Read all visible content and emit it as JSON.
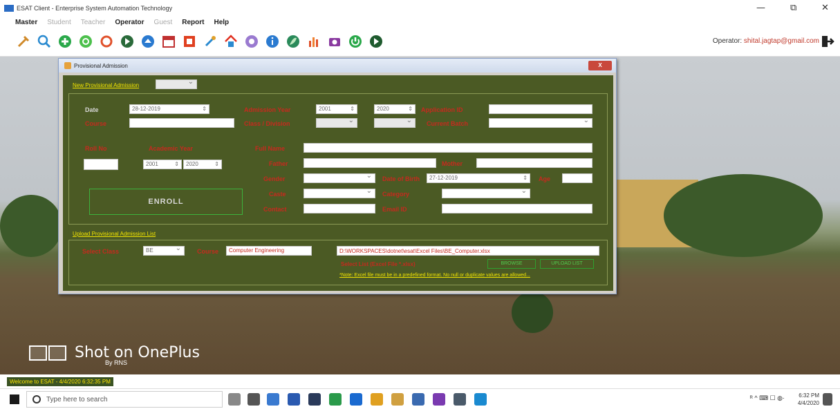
{
  "window": {
    "title": "ESAT Client - Enterprise System Automation Technology",
    "minimize": "—",
    "maximize": "⧉",
    "close": "✕"
  },
  "menu": {
    "items": [
      {
        "label": "Master",
        "enabled": true
      },
      {
        "label": "Student",
        "enabled": false
      },
      {
        "label": "Teacher",
        "enabled": false
      },
      {
        "label": "Operator",
        "enabled": true
      },
      {
        "label": "Guest",
        "enabled": false
      },
      {
        "label": "Report",
        "enabled": true
      },
      {
        "label": "Help",
        "enabled": true
      }
    ]
  },
  "toolbar": {
    "operator_prefix": "Operator: ",
    "operator_email": "shital.jagtap@gmail.com",
    "icons": [
      "tools-icon",
      "search-icon",
      "add-icon",
      "refresh-green-icon",
      "sync-icon",
      "next-icon",
      "upload-icon",
      "calendar-icon",
      "pdf-icon",
      "pin-icon",
      "home-icon",
      "flower-icon",
      "info-icon",
      "leaf-icon",
      "chart-icon",
      "camera-icon",
      "power-icon",
      "arrow-right-icon"
    ]
  },
  "dialog": {
    "title": "Provisional Admission",
    "close_label": "X",
    "new_admission_link": "New Provisional Admission",
    "new_admission_select": "",
    "date_label": "Date",
    "date_value": "28-12-2019",
    "admission_year_label": "Admission Year",
    "admission_year_from": "2001",
    "admission_year_to": "2020",
    "application_id_label": "Application ID",
    "application_id_value": "",
    "course_label": "Course",
    "course_value": "",
    "class_division_label": "Class / Division",
    "class_value": "",
    "division_value": "",
    "current_batch_label": "Current Batch",
    "current_batch_value": "",
    "roll_no_label": "Roll No",
    "roll_no_value": "",
    "academic_year_label": "Academic Year",
    "academic_year_from": "2001",
    "academic_year_to": "2020",
    "full_name_label": "Full Name",
    "full_name_value": "",
    "father_label": "Father",
    "father_value": "",
    "mother_label": "Mother",
    "mother_value": "",
    "gender_label": "Gender",
    "gender_value": "",
    "dob_label": "Date of Birth",
    "dob_value": "27-12-2019",
    "age_label": "Age",
    "age_value": "",
    "caste_label": "Caste",
    "caste_value": "",
    "category_label": "Category",
    "category_value": "",
    "contact_label": "Contact",
    "contact_value": "",
    "email_label": "Email ID",
    "email_value": "",
    "enroll_label": "ENROLL",
    "upload_link": "Upload Provisional Admission List",
    "select_class_label": "Select Class",
    "select_class_value": "BE",
    "course2_label": "Course",
    "course2_value": "Computer Engineering",
    "file_path": "D:\\WORKSPACES\\dotnet\\esat\\Excel Files\\BE_Computer.xlsx",
    "select_list_label": "Select List (Excel File *.xlsx)",
    "browse_label": "BROWSE",
    "upload_list_label": "UPLOAD LIST",
    "note": "*Note: Excel file must be in a predefined format. No null or duplicate values are allowed..."
  },
  "photo": {
    "watermark": "Shot on OnePlus",
    "watermark_by": "By RNS"
  },
  "status": {
    "text": "Welcome to ESAT - 4/4/2020 6:32:35 PM"
  },
  "taskbar": {
    "search_placeholder": "Type here to search",
    "time": "6:32 PM",
    "date": "4/4/2020",
    "tray": "ᴿ ^ ⌨ ☐ ◍·"
  }
}
